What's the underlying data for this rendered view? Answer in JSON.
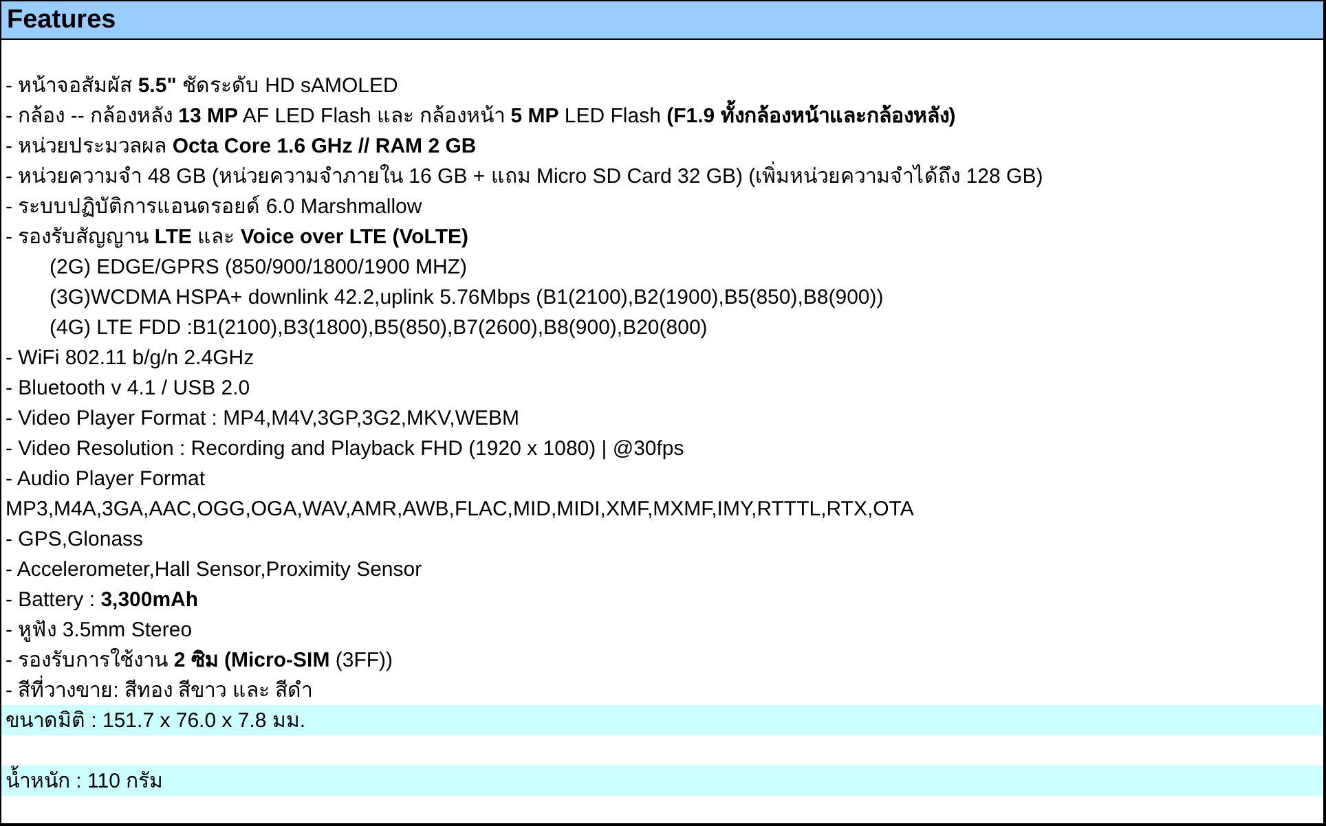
{
  "title": "Features",
  "lines": [
    {
      "kind": "item",
      "text": "- หน้าจอสัมผัส **5.5\"** ชัดระดับ HD sAMOLED"
    },
    {
      "kind": "item",
      "text": "- กล้อง -- กล้องหลัง **13 MP** AF LED Flash และ กล้องหน้า **5 MP** LED Flash **(F1.9 ทั้งกล้องหน้าและกล้องหลัง)**"
    },
    {
      "kind": "item",
      "text": "- หน่วยประมวลผล **Octa Core  1.6 GHz  //  RAM 2 GB**"
    },
    {
      "kind": "item",
      "text": "- หน่วยความจำ 48 GB (หน่วยความจำภายใน 16 GB + แถม Micro SD Card 32 GB) (เพิ่มหน่วยความจำได้ถึง 128 GB)"
    },
    {
      "kind": "item",
      "text": "- ระบบปฏิบัติการแอนดรอยด์ 6.0 Marshmallow"
    },
    {
      "kind": "item",
      "text": "- รองรับสัญญาน **LTE** และ **Voice over LTE (VoLTE)**"
    },
    {
      "kind": "indent",
      "text": "(2G) EDGE/GPRS (850/900/1800/1900 MHZ)"
    },
    {
      "kind": "indent",
      "text": "(3G)WCDMA HSPA+ downlink 42.2,uplink 5.76Mbps (B1(2100),B2(1900),B5(850),B8(900))"
    },
    {
      "kind": "indent",
      "text": "(4G) LTE FDD :B1(2100),B3(1800),B5(850),B7(2600),B8(900),B20(800)"
    },
    {
      "kind": "item",
      "text": "- WiFi 802.11 b/g/n 2.4GHz"
    },
    {
      "kind": "item",
      "text": "- Bluetooth v 4.1 / USB 2.0"
    },
    {
      "kind": "item",
      "text": "- Video Player Format : MP4,M4V,3GP,3G2,MKV,WEBM"
    },
    {
      "kind": "item",
      "text": "- Video Resolution :  Recording and Playback FHD (1920 x 1080) | @30fps"
    },
    {
      "kind": "item",
      "text": "- Audio Player Format"
    },
    {
      "kind": "item",
      "text": "MP3,M4A,3GA,AAC,OGG,OGA,WAV,AMR,AWB,FLAC,MID,MIDI,XMF,MXMF,IMY,RTTTL,RTX,OTA"
    },
    {
      "kind": "item",
      "text": "- GPS,Glonass"
    },
    {
      "kind": "item",
      "text": "- Accelerometer,Hall Sensor,Proximity Sensor"
    },
    {
      "kind": "item",
      "text": "- Battery : **3,300mAh**"
    },
    {
      "kind": "item",
      "text": "- หูฟัง 3.5mm Stereo"
    },
    {
      "kind": "item",
      "text": "- รองรับการใช้งาน **2 ซิม (Micro-SIM** (3FF))"
    },
    {
      "kind": "item",
      "text": "- สีที่วางขาย: สีทอง สีขาว และ สีดำ"
    }
  ],
  "specs": [
    {
      "text": "ขนาดมิติ :  151.7 x 76.0 x 7.8 มม."
    },
    {
      "text": "น้ำหนัก : 110 กรัม"
    }
  ]
}
